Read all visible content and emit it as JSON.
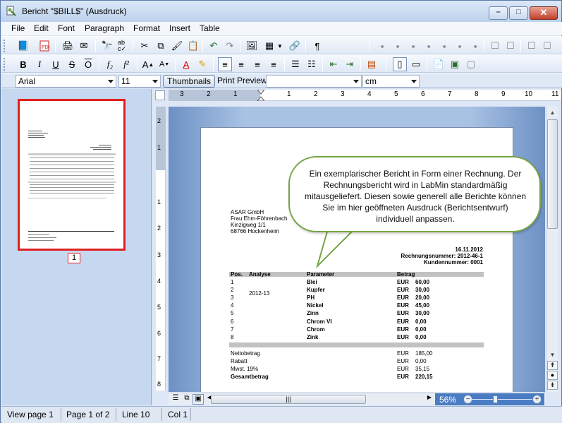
{
  "window": {
    "title": "Bericht \"$BILL$\" (Ausdruck)"
  },
  "menu": [
    "File",
    "Edit",
    "Font",
    "Paragraph",
    "Format",
    "Insert",
    "Table"
  ],
  "format_bar": {
    "font_name": "Arial",
    "font_size": "11",
    "thumbnails_tab": "Thumbnails",
    "print_preview_tab": "Print Preview",
    "style_value": "",
    "unit_value": "cm"
  },
  "thumbnail": {
    "page_label": "1"
  },
  "ruler": {
    "h_labels": [
      "3",
      "2",
      "1",
      "1",
      "2",
      "3",
      "4",
      "5",
      "6",
      "7",
      "8",
      "9",
      "10",
      "11"
    ],
    "v_labels": [
      "2",
      "1",
      "1",
      "2",
      "3",
      "4",
      "5",
      "6",
      "7",
      "8"
    ]
  },
  "callout": {
    "text": "Ein exemplarischer Bericht in Form einer Rechnung. Der Rechnungsbericht wird in LabMin standardmäßig mitausgeliefert. Diesen sowie generell alle Berichte können Sie im hier geöffneten Ausdruck (Berichtsentwurf) individuell anpassen."
  },
  "document": {
    "address": [
      "ASAR GmbH",
      "Frau Ehm-Föhrenbach",
      "Kinzigweg 1/1",
      "68766 Hockenheim"
    ],
    "date": "16.11.2012",
    "invoice_number": "Rechnungsnummer: 2012-46-1",
    "customer_number": "Kundennummer: 0001",
    "headers": {
      "pos": "Pos.",
      "analysis": "Analyse",
      "parameter": "Parameter",
      "amount": "Betrag"
    },
    "rows": [
      {
        "pos": "1",
        "analysis": "",
        "parameter": "Blei",
        "cur": "EUR",
        "value": "60,00"
      },
      {
        "pos": "2",
        "analysis": "2012-13",
        "parameter": "Kupfer",
        "cur": "EUR",
        "value": "30,00"
      },
      {
        "pos": "3",
        "analysis": "",
        "parameter": "PH",
        "cur": "EUR",
        "value": "20,00"
      },
      {
        "pos": "4",
        "analysis": "",
        "parameter": "Nickel",
        "cur": "EUR",
        "value": "45,00"
      },
      {
        "pos": "5",
        "analysis": "",
        "parameter": "Zinn",
        "cur": "EUR",
        "value": "30,00"
      },
      {
        "pos": "6",
        "analysis": "",
        "parameter": "Chrom VI",
        "cur": "EUR",
        "value": "0,00"
      },
      {
        "pos": "7",
        "analysis": "",
        "parameter": "Chrom",
        "cur": "EUR",
        "value": "0,00"
      },
      {
        "pos": "8",
        "analysis": "",
        "parameter": "Zink",
        "cur": "EUR",
        "value": "0,00"
      }
    ],
    "totals": [
      {
        "label": "Nettobetrag",
        "cur": "EUR",
        "value": "185,00",
        "bold": false
      },
      {
        "label": "Rabatt",
        "cur": "EUR",
        "value": "0,00",
        "bold": false
      },
      {
        "label": "Mwst. 19%",
        "cur": "EUR",
        "value": "35,15",
        "bold": false
      },
      {
        "label": "Gesamtbetrag",
        "cur": "EUR",
        "value": "220,15",
        "bold": true
      }
    ]
  },
  "zoom": {
    "label": "56%"
  },
  "status": {
    "view": "View page 1",
    "page": "Page 1 of 2",
    "line": "Line 10",
    "col": "Col 1"
  },
  "colors": {
    "accent": "#4a7cc3",
    "thumb_border": "#e02020",
    "callout_border": "#75a547"
  }
}
